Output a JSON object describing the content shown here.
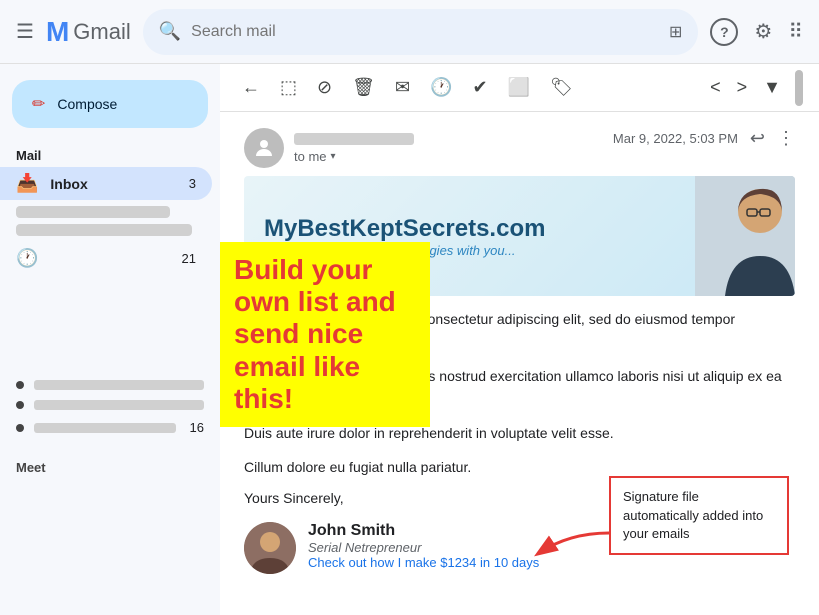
{
  "topbar": {
    "search_placeholder": "Search mail",
    "gmail_label": "Gmail"
  },
  "sidebar": {
    "compose_label": "Compose",
    "mail_label": "Mail",
    "inbox_label": "Inbox",
    "inbox_count": "3",
    "snoozed_count": "",
    "other_count": "21",
    "bottom_count": "16"
  },
  "toolbar": {
    "back_label": "←",
    "archive_label": "⬜",
    "report_label": "⊘",
    "delete_label": "🗑",
    "mail_label": "✉",
    "snooze_label": "🕐",
    "task_label": "✔",
    "move_label": "⬜",
    "label_label": "🏷",
    "prev_label": "<",
    "next_label": ">",
    "more_label": "▼"
  },
  "email": {
    "date": "Mar 9, 2022, 5:03 PM",
    "to_me": "to me",
    "banner_site": "MyBestKeptSecrets.com",
    "banner_tagline": "Sharing my best traffic strategies with you...",
    "para1": "Lorem ipsum dolor sit amet, consectetur adipiscing elit, sed do eiusmod tempor incididunt ut.",
    "para2": "Ut enim ad minim veniam, quis nostrud exercitation ullamco laboris nisi ut aliquip ex ea commodo consequat.",
    "para3": "Duis aute irure dolor in reprehenderit in voluptate velit esse.",
    "para4": "Cillum dolore eu fugiat nulla pariatur.",
    "closing": "Yours Sincerely,",
    "sig_name": "John Smith",
    "sig_title": "Serial Netrepreneur",
    "sig_link": "Check out how I make $1234 in 10 days"
  },
  "overlay": {
    "yellow_text": "Build your own list and send nice email like this!",
    "callout_text": "Signature file automatically added into your emails"
  },
  "icons": {
    "hamburger": "☰",
    "search": "🔍",
    "filter": "⚙",
    "help": "?",
    "settings": "⚙",
    "apps": "⋮⋮",
    "reply": "↩",
    "more_vert": "⋮",
    "chevron_down": "▾",
    "person": "👤"
  }
}
